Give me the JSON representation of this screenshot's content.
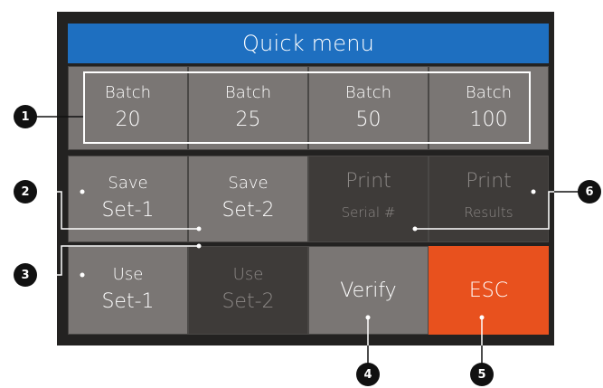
{
  "title": "Quick menu",
  "colors": {
    "title_bar": "#1e6fc0",
    "button": "#7a7674",
    "button_disabled": "#3e3b39",
    "esc": "#e8511e",
    "background": "#232221"
  },
  "row1": [
    {
      "line1": "Batch",
      "line2": "20"
    },
    {
      "line1": "Batch",
      "line2": "25"
    },
    {
      "line1": "Batch",
      "line2": "50"
    },
    {
      "line1": "Batch",
      "line2": "100"
    }
  ],
  "row2": [
    {
      "line1": "Save",
      "line2": "Set-1",
      "state": "enabled"
    },
    {
      "line1": "Save",
      "line2": "Set-2",
      "state": "enabled"
    },
    {
      "line1": "Print",
      "line2": "Serial #",
      "state": "disabled"
    },
    {
      "line1": "Print",
      "line2": "Results",
      "state": "disabled"
    }
  ],
  "row3": [
    {
      "line1": "Use",
      "line2": "Set-1",
      "state": "enabled"
    },
    {
      "line1": "Use",
      "line2": "Set-2",
      "state": "disabled"
    },
    {
      "label": "Verify",
      "state": "enabled"
    },
    {
      "label": "ESC",
      "state": "enabled"
    }
  ],
  "callouts": [
    "1",
    "2",
    "3",
    "4",
    "5",
    "6"
  ]
}
